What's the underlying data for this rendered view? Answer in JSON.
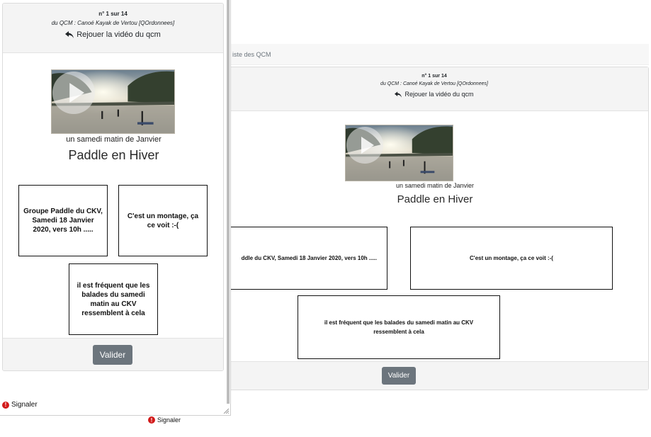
{
  "question": {
    "number": "n° 1 sur 14",
    "source": "du QCM : Canoé Kayak de Vertou [QOrdonnees]",
    "replay_label": "Rejouer la vidéo du qcm",
    "image_caption": "un samedi matin de Janvier",
    "title": "Paddle en Hiver"
  },
  "answers": [
    {
      "text": "Groupe Paddle du CKV, Samedi 18 Janvier 2020, vers 10h ....."
    },
    {
      "text": "C'est un montage, ça ce voit :-("
    },
    {
      "text": "il est fréquent que les balades du samedi matin au CKV ressemblent à cela"
    }
  ],
  "background_view": {
    "breadcrumb": "iste des QCM",
    "first_answer_visible": "ddle du CKV, Samedi 18 Janvier 2020, vers 10h ....."
  },
  "actions": {
    "submit_label": "Valider",
    "report_label": "Signaler"
  },
  "icons": {
    "replay": "reply-arrow-icon",
    "play": "play-icon",
    "report": "exclamation-circle-icon"
  },
  "colors": {
    "submit_bg": "#6c757d",
    "report_icon": "#d21a1a",
    "card_header_bg": "#f4f4f4"
  }
}
